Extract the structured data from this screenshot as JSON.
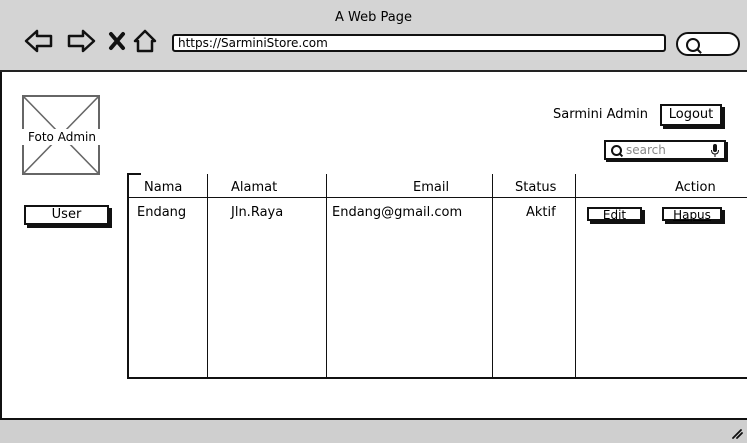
{
  "browser": {
    "page_title": "A Web Page",
    "url": "https://SarminiStore.com"
  },
  "sidebar": {
    "photo_label": "Foto Admin",
    "user_button_label": "User"
  },
  "header": {
    "admin_name": "Sarmini Admin",
    "logout_label": "Logout",
    "search_placeholder": "search"
  },
  "table": {
    "columns": [
      "Nama",
      "Alamat",
      "Email",
      "Status",
      "Action"
    ],
    "rows": [
      {
        "nama": "Endang",
        "alamat": "Jln.Raya",
        "email": "Endang@gmail.com",
        "status": "Aktif",
        "edit_label": "Edit",
        "hapus_label": "Hapus"
      }
    ]
  },
  "icons": {
    "back": "arrow-left-icon",
    "forward": "arrow-right-icon",
    "close": "close-icon",
    "home": "home-icon",
    "search": "search-icon",
    "mic": "microphone-icon",
    "resize": "resize-grip-icon"
  }
}
